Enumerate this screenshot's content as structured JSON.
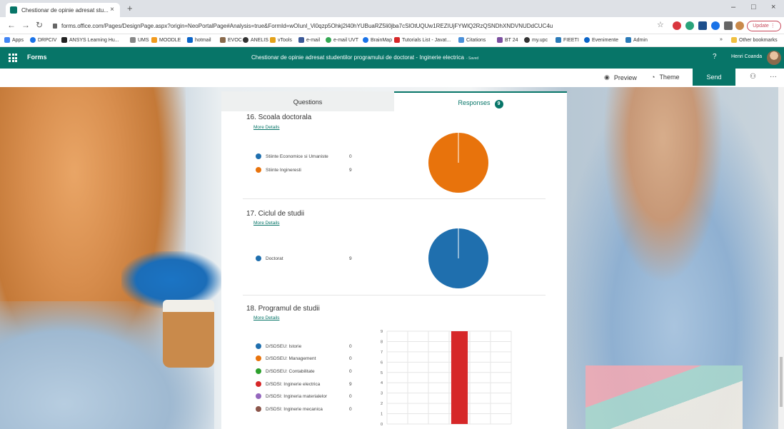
{
  "browser": {
    "tab_title": "Chestionar de opinie adresat stu...",
    "tab_close": "×",
    "new_tab": "+",
    "url": "forms.office.com/Pages/DesignPage.aspx?origin=NeoPortalPage#Analysis=true&FormId=wOIunl_Vi0qzp5Ohkj2l40hYUBuaRZ5li0jba7cSlOtUQUw1REZIUjFYWlQ2RzQSNDhXNDVNUDdCUC4u",
    "update_label": "Update",
    "min": "–",
    "max": "□",
    "close": "×",
    "bookmarks": [
      "Apps",
      "DRPCIV",
      "ANSYS Learning Hu...",
      "UMS",
      "MOODLE",
      "hotmail",
      "EVOC",
      "ANELIS",
      "vTools",
      "e-mail",
      "e-mail UVT",
      "BrainMap",
      "Tutorials List - Javat...",
      "Citations",
      "BT 24",
      "my.upc",
      "FIEETI",
      "Evenimente",
      "Admin"
    ],
    "other_bookmarks": "Other bookmarks",
    "bm_more": "»"
  },
  "forms": {
    "brand": "Forms",
    "title": "Chestionar de opinie adresat studentilor programului de doctorat - Inginerie electrica",
    "saved": "- Saved",
    "help": "?",
    "user": "Henri Coanda"
  },
  "commands": {
    "preview": "Preview",
    "theme": "Theme",
    "send": "Send",
    "more": "···"
  },
  "panel": {
    "tab_questions": "Questions",
    "tab_responses": "Responses",
    "responses_count": "9"
  },
  "questions": [
    {
      "title": "16. Scoala doctorala",
      "more": "More Details",
      "options": [
        {
          "label": "Stiinte Economice si Umaniste",
          "count": "0",
          "color": "#1f6fae"
        },
        {
          "label": "Stiinte Ingineresti",
          "count": "9",
          "color": "#e8730c"
        }
      ]
    },
    {
      "title": "17. Ciclul de studii",
      "more": "More Details",
      "options": [
        {
          "label": "Doctorat",
          "count": "9",
          "color": "#1f6fae"
        }
      ]
    },
    {
      "title": "18. Programul de studii",
      "more": "More Details",
      "options": [
        {
          "label": "D/SDSEU: Istorie",
          "count": "0",
          "color": "#1f6fae"
        },
        {
          "label": "D/SDSEU: Management",
          "count": "0",
          "color": "#e8730c"
        },
        {
          "label": "D/SDSEU: Contabilitate",
          "count": "0",
          "color": "#2ca02c"
        },
        {
          "label": "D/SDSI: Inginerie electrica",
          "count": "9",
          "color": "#d62728"
        },
        {
          "label": "D/SDSI: Ingineria materialelor",
          "count": "0",
          "color": "#9467bd"
        },
        {
          "label": "D/SDSI: Inginerie mecanica",
          "count": "0",
          "color": "#8c564b"
        }
      ]
    }
  ],
  "chart_data": [
    {
      "type": "pie",
      "labels": [
        "Stiinte Economice si Umaniste",
        "Stiinte Ingineresti"
      ],
      "values": [
        0,
        9
      ],
      "colors": [
        "#1f6fae",
        "#e8730c"
      ]
    },
    {
      "type": "pie",
      "labels": [
        "Doctorat"
      ],
      "values": [
        9
      ],
      "colors": [
        "#1f6fae"
      ]
    },
    {
      "type": "bar",
      "categories": [
        "D/SDSEU: Istorie",
        "D/SDSEU: Management",
        "D/SDSEU: Contabilitate",
        "D/SDSI: Inginerie electrica",
        "D/SDSI: Ingineria materialelor",
        "D/SDSI: Inginerie mecanica"
      ],
      "values": [
        0,
        0,
        0,
        9,
        0,
        0
      ],
      "colors": [
        "#1f6fae",
        "#e8730c",
        "#2ca02c",
        "#d62728",
        "#9467bd",
        "#8c564b"
      ],
      "ylim": [
        0,
        9
      ],
      "yticks": [
        "0",
        "1",
        "2",
        "3",
        "4",
        "5",
        "6",
        "7",
        "8",
        "9"
      ],
      "grid": true
    }
  ]
}
